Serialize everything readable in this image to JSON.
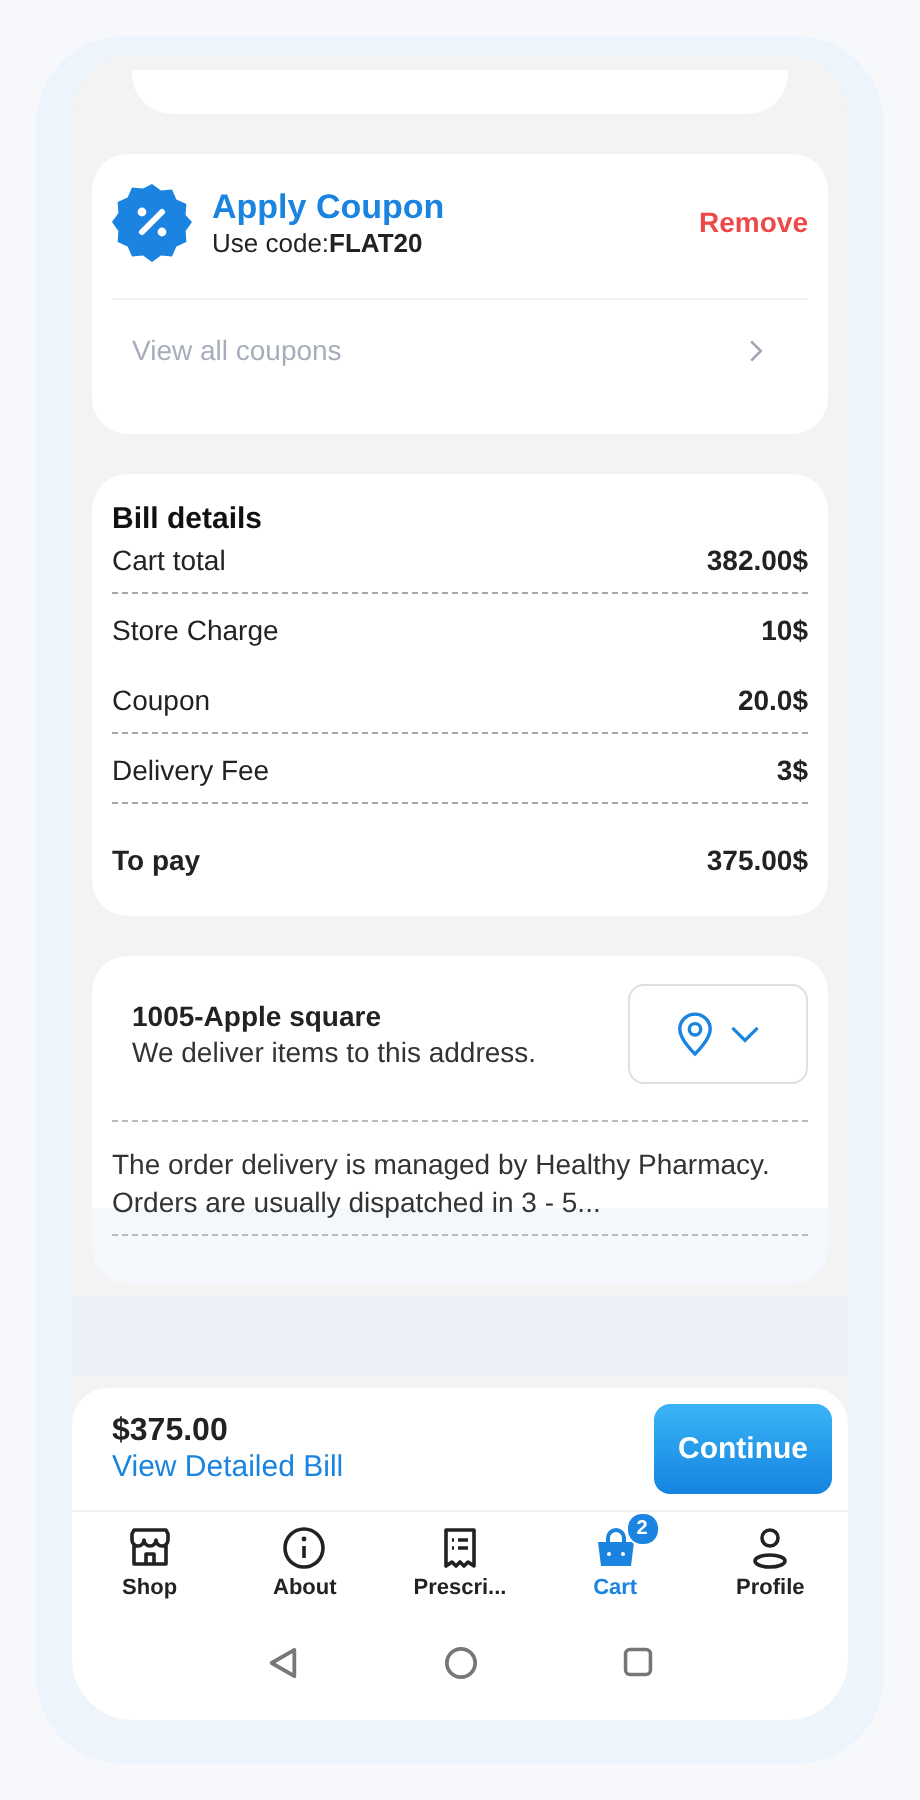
{
  "coupon": {
    "title": "Apply Coupon",
    "code_label": "Use code:",
    "code": "FLAT20",
    "remove": "Remove",
    "view_all": "View all coupons"
  },
  "bill": {
    "title": "Bill details",
    "rows": [
      {
        "label": "Cart total",
        "value": "382.00$",
        "divider": true
      },
      {
        "label": "Store Charge",
        "value": "10$",
        "divider": false
      },
      {
        "label": "Coupon",
        "value": "20.0$",
        "divider": true
      },
      {
        "label": "Delivery Fee",
        "value": "3$",
        "divider": true
      }
    ],
    "total": {
      "label": "To pay",
      "value": "375.00$"
    }
  },
  "address": {
    "title": "1005-Apple square",
    "subtitle": "We deliver items to this address.",
    "note": "The order delivery is managed by Healthy Pharmacy. Orders are usually dispatched in 3 - 5..."
  },
  "checkout": {
    "amount": "$375.00",
    "link": "View Detailed Bill",
    "button": "Continue"
  },
  "nav": [
    {
      "kind": "shop",
      "label": "Shop",
      "selected": false
    },
    {
      "kind": "about",
      "label": "About",
      "selected": false
    },
    {
      "kind": "prescription",
      "label": "Prescri...",
      "selected": false
    },
    {
      "kind": "cart",
      "label": "Cart",
      "selected": true,
      "badge": "2"
    },
    {
      "kind": "profile",
      "label": "Profile",
      "selected": false
    }
  ]
}
